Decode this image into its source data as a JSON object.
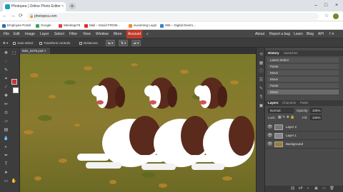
{
  "browser": {
    "tab_title": "Photopea | Online Photo Editor",
    "tab_close": "×",
    "new_tab": "+",
    "window_controls": [
      "–",
      "□",
      "×"
    ],
    "nav": [
      "←",
      "→",
      "⟳"
    ],
    "url": "photopea.com",
    "bookmarks": [
      {
        "label": "Employee Portal",
        "color": "#2b6cb0"
      },
      {
        "label": "Google",
        "color": "#34a853"
      },
      {
        "label": "Meetings75",
        "color": "#e53e3e"
      },
      {
        "label": "Mail – David FROM...",
        "color": "#d93025"
      },
      {
        "label": "eLearning Login",
        "color": "#ed8936"
      },
      {
        "label": "365 – Digital Divers...",
        "color": "#3182ce"
      }
    ]
  },
  "app": {
    "menus": [
      "File",
      "Edit",
      "Image",
      "Layer",
      "Select",
      "Filter",
      "View",
      "Window",
      "More"
    ],
    "account": "Account",
    "right_links": [
      "About",
      "Report a bug",
      "Learn",
      "Blog",
      "API"
    ],
    "options": {
      "auto_select": "Auto-select",
      "transform_controls": "Transform controls",
      "distances": "Distances",
      "buttons": [
        "⇆ ▾",
        "⇅ ▾",
        "⇄ ▾"
      ]
    },
    "doc_tab": "IMG_0479.psd ×",
    "history": {
      "tabs": [
        "History",
        "Swatches"
      ],
      "items": [
        "Lasso Select",
        "Paste",
        "Move",
        "Move",
        "Paste",
        "Move"
      ],
      "selected_index": 5
    },
    "layers": {
      "tabs": [
        "Layers",
        "Channels",
        "Paths"
      ],
      "blend_mode": "Normal",
      "opacity_label": "Opacity:",
      "opacity_value": "100%",
      "lock_label": "Lock:",
      "fill_label": "Fill:",
      "fill_value": "100%",
      "items": [
        {
          "name": "Layer 2",
          "color": "#777"
        },
        {
          "name": "Layer 1",
          "color": "#888"
        },
        {
          "name": "Background",
          "color": "#9a7b3a"
        }
      ],
      "footer_icons": [
        "⛓",
        "eff",
        "◐",
        "▣",
        "▭",
        "🗑"
      ]
    },
    "colors": {
      "foreground": "#d32f2f",
      "background": "#ffffff"
    }
  }
}
